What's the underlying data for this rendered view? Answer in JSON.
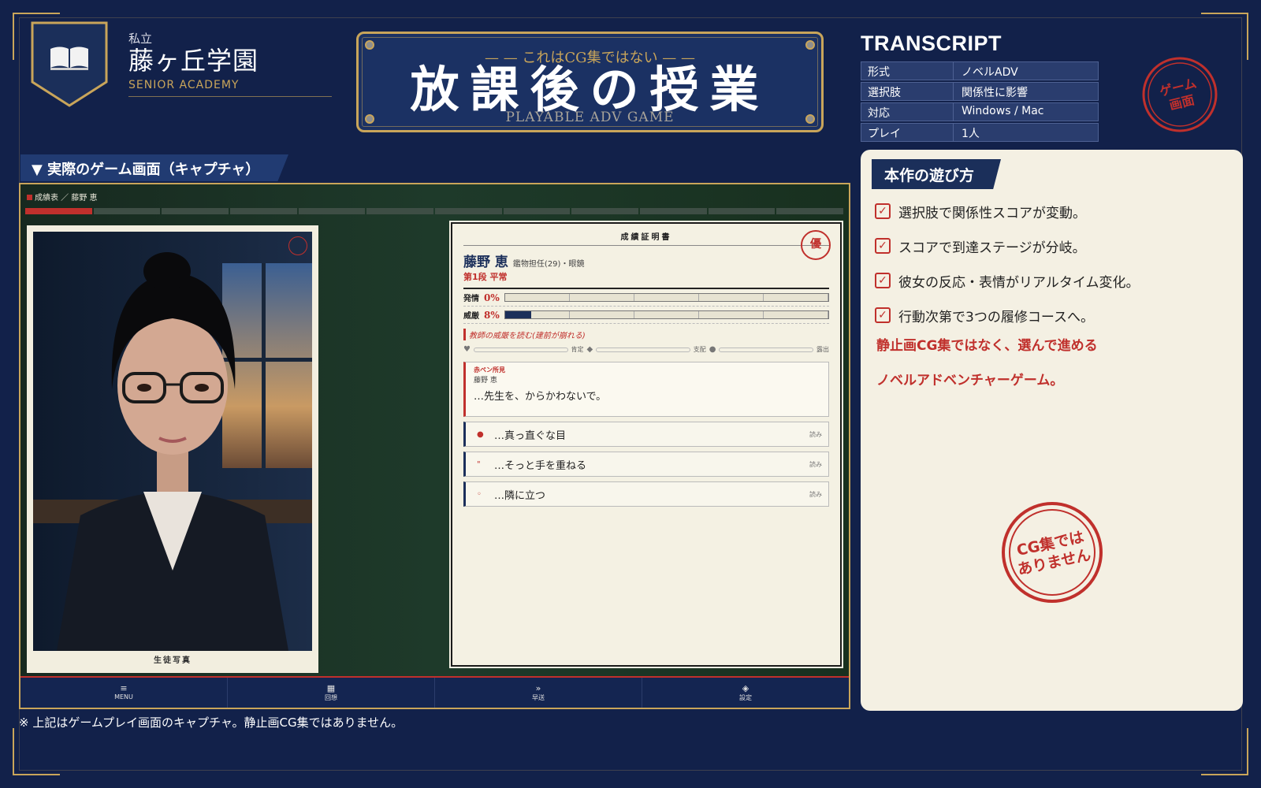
{
  "school": {
    "kind": "私立",
    "name": "藤ヶ丘学園",
    "en": "SENIOR ACADEMY"
  },
  "title": {
    "sub": "— — これはCG集ではない — —",
    "main": "放課後の授業",
    "en": "PLAYABLE ADV GAME"
  },
  "transcript": {
    "heading": "TRANSCRIPT",
    "rows": [
      {
        "k": "形式",
        "v": "ノベルADV"
      },
      {
        "k": "選択肢",
        "v": "関係性に影響"
      },
      {
        "k": "対応",
        "v": "Windows / Mac"
      },
      {
        "k": "プレイ",
        "v": "1人"
      }
    ]
  },
  "stamp_top": [
    "ゲーム",
    "画面"
  ],
  "section": {
    "label": "▼ 実際のゲーム画面（キャプチャ）"
  },
  "game": {
    "crumb": "成績表 ／ 藤野 恵",
    "progress_filled_segments": 1,
    "progress_total_segments": 12,
    "photo_caption": "生徒写真",
    "report": {
      "head": "成績証明書",
      "seal": "優",
      "name": "藤野 恵",
      "role": "鑑物担任(29)・眼鏡",
      "level": "第1段 平常",
      "stats": [
        {
          "label": "発情",
          "pct": "0%",
          "value": 0
        },
        {
          "label": "威厳",
          "pct": "8%",
          "value": 8
        }
      ],
      "note": "教師の威厳を読む(建前が崩れる)",
      "axes": [
        "肯定",
        "支配",
        "露出"
      ],
      "memo": {
        "title": "赤ペン所見",
        "who": "藤野 恵",
        "msg": "…先生を、からかわないで。"
      },
      "choices": [
        {
          "bullet": "●",
          "text": "…真っ直ぐな目",
          "read": "読み"
        },
        {
          "bullet": "\"",
          "text": "…そっと手を重ねる",
          "read": "読み"
        },
        {
          "bullet": "◦",
          "text": "…隣に立つ",
          "read": "読み"
        }
      ]
    },
    "menu": [
      {
        "icon": "≡",
        "label": "MENU"
      },
      {
        "icon": "▦",
        "label": "回想"
      },
      {
        "icon": "»",
        "label": "早送"
      },
      {
        "icon": "◈",
        "label": "設定"
      }
    ]
  },
  "footnote": "※ 上記はゲームプレイ画面のキャプチャ。静止画CG集ではありません。",
  "howto": {
    "tab": "本作の遊び方",
    "items": [
      "選択肢で関係性スコアが変動。",
      "スコアで到達ステージが分岐。",
      "彼女の反応・表情がリアルタイム変化。",
      "行動次第で3つの履修コースへ。"
    ],
    "red1": "静止画CG集ではなく、選んで進める",
    "red2": "ノベルアドベンチャーゲーム。",
    "stamp": [
      "CG集では",
      "ありません"
    ]
  },
  "colors": {
    "navy": "#12214a",
    "gold": "#c9a55a",
    "red": "#c0302c",
    "paper": "#f4f0e3"
  }
}
